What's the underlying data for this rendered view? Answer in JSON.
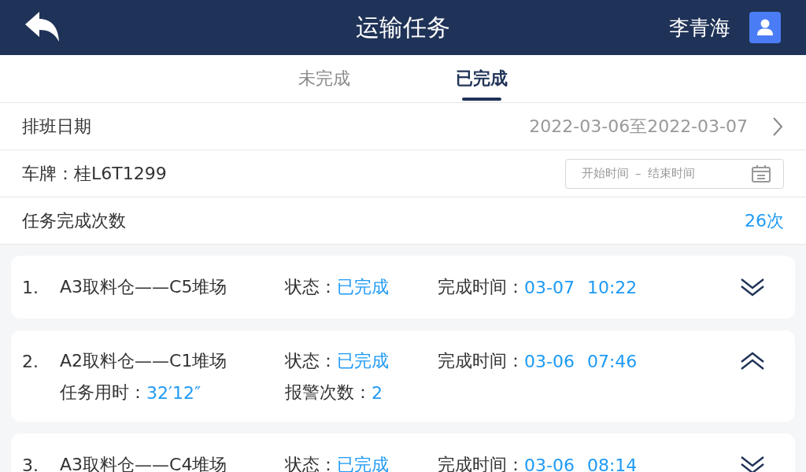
{
  "header": {
    "title": "运输任务",
    "user_name": "李青海"
  },
  "tabs": [
    {
      "label": "未完成",
      "selected": false
    },
    {
      "label": "已完成",
      "selected": true
    }
  ],
  "schedule": {
    "label": "排班日期",
    "value": "2022-03-06至2022-03-07"
  },
  "plate": {
    "label": "车牌：",
    "value": "桂L6T1299",
    "start_placeholder": "开始时间",
    "separator": "–",
    "end_placeholder": "结束时间"
  },
  "completed_count": {
    "label": "任务完成次数",
    "value": "26次"
  },
  "tasks": [
    {
      "index": "1.",
      "route": "A3取料仓——C5堆场",
      "status_label": "状态：",
      "status": "已完成",
      "time_label": "完成时间：",
      "date": "03-07",
      "time": "10:22",
      "expanded": false
    },
    {
      "index": "2.",
      "route": "A2取料仓——C1堆场",
      "status_label": "状态：",
      "status": "已完成",
      "time_label": "完成时间：",
      "date": "03-06",
      "time": "07:46",
      "expanded": true,
      "duration_label": "任务用时：",
      "duration": "32′12″",
      "alarm_label": "报警次数：",
      "alarm_count": "2"
    },
    {
      "index": "3.",
      "route": "A3取料仓——C4堆场",
      "status_label": "状态：",
      "status": "已完成",
      "time_label": "完成时间：",
      "date": "03-06",
      "time": "08:14",
      "expanded": false
    }
  ]
}
